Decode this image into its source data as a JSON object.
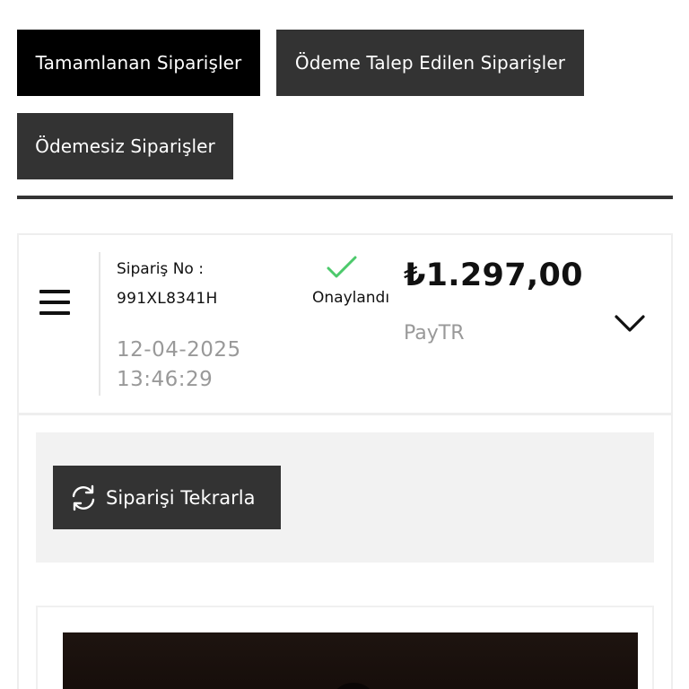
{
  "tabs": {
    "completed": "Tamamlanan Siparişler",
    "payment_requested": "Ödeme Talep Edilen Siparişler",
    "unpaid": "Ödemesiz Siparişler",
    "active": "completed"
  },
  "order": {
    "order_no_label": "Sipariş No :",
    "order_no": "991XL8341H",
    "date": "12-04-2025",
    "time": "13:46:29",
    "status": "Onaylandı",
    "status_icon": "check-icon",
    "status_color": "#4cc96b",
    "price": "₺1.297,00",
    "payment_method": "PayTR",
    "reorder_label": "Siparişi Tekrarla"
  },
  "colors": {
    "active_tab": "#000000",
    "inactive_tab": "#333333",
    "muted_text": "#999999"
  }
}
